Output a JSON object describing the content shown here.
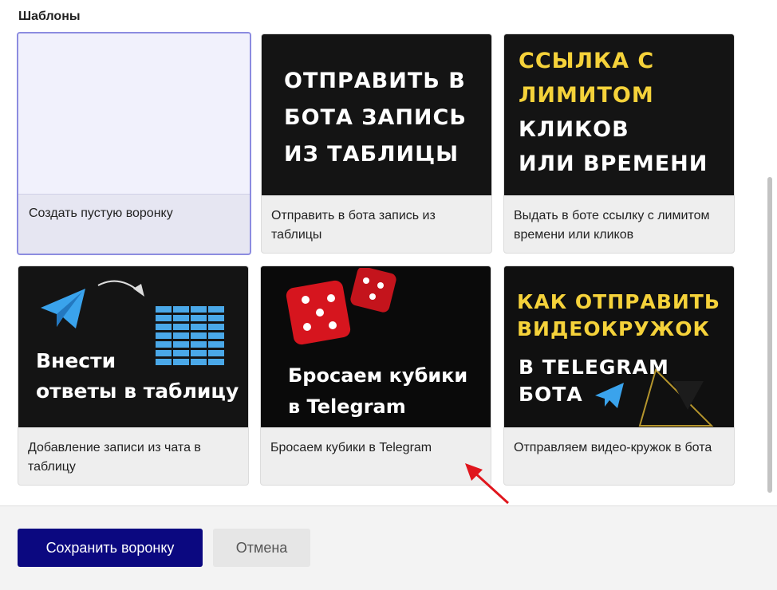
{
  "section": {
    "title": "Шаблоны"
  },
  "templates": [
    {
      "caption": "Создать пустую воронку",
      "selected": true
    },
    {
      "caption": "Отправить в бота запись из таблицы",
      "thumb_lines": [
        "Отправить в",
        "бота запись",
        "из таблицы"
      ]
    },
    {
      "caption": "Выдать в боте ссылку с лимитом времени или кликов",
      "thumb_lines": [
        "Ссылка с",
        "лимитом",
        "кликов",
        "или времени"
      ]
    },
    {
      "caption": "Добавление записи из чата в таблицу",
      "thumb_lines": [
        "Внести",
        "ответы в таблицу"
      ]
    },
    {
      "caption": "Бросаем кубики в Telegram",
      "thumb_lines": [
        "Бросаем кубики",
        "в Telegram"
      ]
    },
    {
      "caption": "Отправляем видео-кружок в бота",
      "thumb_lines": [
        "Как отправить",
        "видеокружок",
        "в Telegram",
        "бота"
      ]
    }
  ],
  "footer": {
    "save_label": "Сохранить воронку",
    "cancel_label": "Отмена"
  },
  "colors": {
    "accent": "#0b0880",
    "selected_border": "#8c8ce0",
    "thumb_yellow": "#f5d23a",
    "annotation_red": "#e0161d"
  }
}
